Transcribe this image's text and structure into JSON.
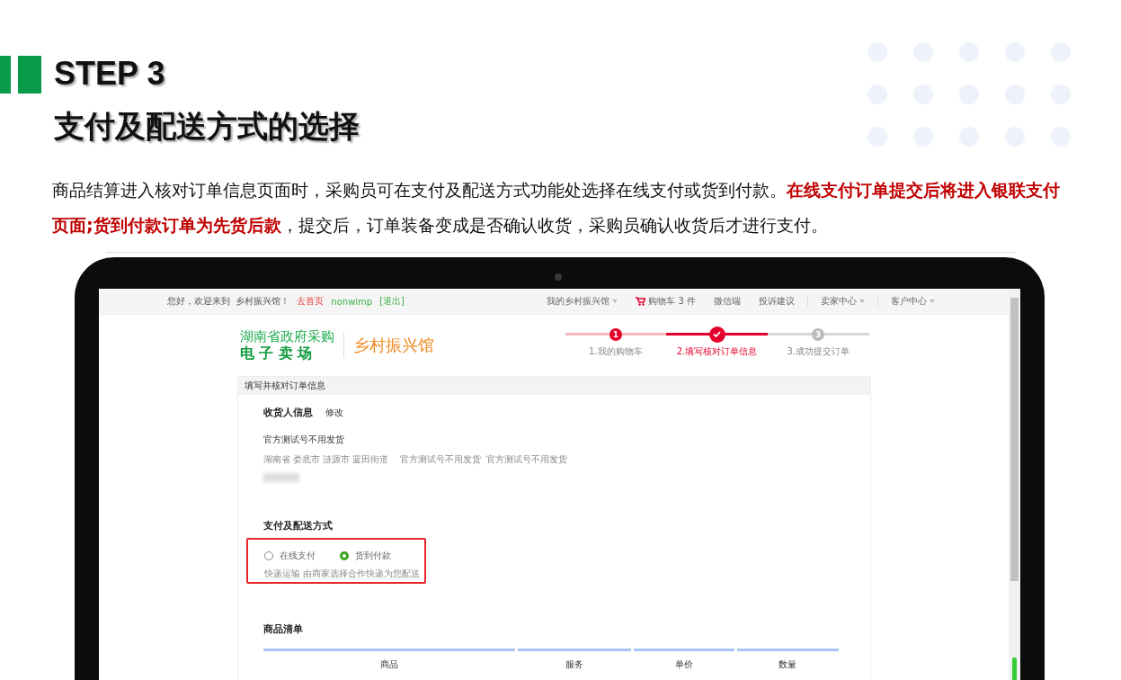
{
  "slide": {
    "step": "STEP 3",
    "title": "支付及配送方式的选择",
    "description": [
      {
        "text": "商品结算进入核对订单信息页面时，采购员可在支付及配送方式功能处选择在线支付或货到付款。",
        "emphasis": false
      },
      {
        "text": "在线支付订单提交后将进入银联支付页面;货到付款订单为先货后款",
        "emphasis": true
      },
      {
        "text": "，提交后，订单装备变成是否确认收货，采购员确认收货后才进行支付。",
        "emphasis": false
      }
    ]
  },
  "top_bar": {
    "greeting": "您好，欢迎来到  乡村振兴馆！",
    "home_link": "去首页",
    "username": "nonwimp",
    "logout": "[退出]",
    "menus": [
      {
        "label": "我的乡村振兴馆",
        "kind": "dropdown"
      },
      {
        "label": "购物车 3 件",
        "kind": "cart"
      },
      {
        "label": "微信端",
        "kind": "plain"
      },
      {
        "label": "投诉建议",
        "kind": "plain"
      },
      {
        "label": "卖家中心",
        "kind": "dropdown"
      },
      {
        "label": "客户中心",
        "kind": "dropdown"
      }
    ]
  },
  "logo": {
    "line_1": "湖南省政府采购",
    "line_2": "电 子 卖 场",
    "name": "乡村振兴馆"
  },
  "steps": [
    {
      "marker": "1",
      "label": "1.我的购物车",
      "done": true,
      "current": false
    },
    {
      "label": "2.填写核对订单信息",
      "done": true,
      "current": true
    },
    {
      "marker": "3",
      "label": "3.成功提交订单",
      "done": false,
      "current": false
    }
  ],
  "panel": {
    "title": "填写并核对订单信息",
    "receiver": {
      "heading": "收货人信息",
      "edit_link": "修改",
      "name": "官方测试号不用发货",
      "address": "湖南省 娄底市 涟源市 蓝田街道    官方测试号不用发货  官方测试号不用发货"
    },
    "payment": {
      "heading": "支付及配送方式",
      "options": [
        {
          "label": "在线支付",
          "selected": false
        },
        {
          "label": "货到付款",
          "selected": true
        }
      ],
      "shipping_note": "快递运输 由商家选择合作快递为您配送"
    },
    "goods": {
      "heading": "商品清单",
      "columns": [
        "商品",
        "服务",
        "单价",
        "数量"
      ]
    }
  }
}
